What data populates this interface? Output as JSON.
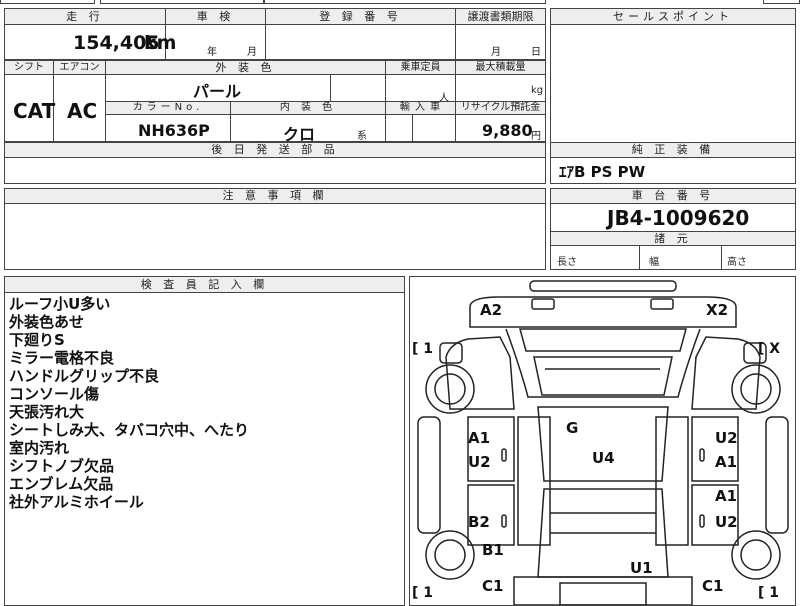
{
  "top": {
    "mileage_label": "走 行",
    "mileage_value": "154,405",
    "mileage_unit": "km",
    "inspection_label": "車 検",
    "inspection_year": "年",
    "inspection_month": "月",
    "registration_label": "登 録 番 号",
    "transfer_label": "譲渡書類期限",
    "transfer_month": "月",
    "transfer_day": "日",
    "sales_point_label": "セールスポイント"
  },
  "specs": {
    "shift_label": "シフト",
    "shift_value": "CAT",
    "aircon_label": "エアコン",
    "aircon_value": "AC",
    "exterior_color_label": "外 装 色",
    "exterior_color_value": "パール",
    "capacity_label": "乗車定員",
    "capacity_unit": "人",
    "max_load_label": "最大積載量",
    "max_load_unit": "kg",
    "color_no_label": "カラーNo.",
    "color_no_value": "NH636P",
    "interior_color_label": "内 装 色",
    "interior_color_value": "クロ",
    "interior_suffix": "系",
    "import_label": "輸 入 車",
    "recycle_label": "リサイクル預託金",
    "recycle_value": "9,880",
    "recycle_unit": "円"
  },
  "shipping_label": "後 日 発 送 部 品",
  "equipment_label": "純 正 装 備",
  "equipment_value": "ｴｱB PS PW",
  "notes_label": "注 意 事 項 欄",
  "chassis_label": "車 台 番 号",
  "chassis_value": "JB4-1009620",
  "dimensions_label": "諸 元",
  "dim_length": "長さ",
  "dim_width": "幅",
  "dim_height": "高さ",
  "inspector_label": "検 査 員 記 入 欄",
  "remarks": [
    "ルーフ小U多い",
    "外装色あせ",
    "下廻りS",
    "ミラー電格不良",
    "ハンドルグリップ不良",
    "コンソール傷",
    "天張汚れ大",
    "シートしみ大、タバコ穴中、へたり",
    "室内汚れ",
    "シフトノブ欠品",
    "エンブレム欠品",
    "社外アルミホイール"
  ],
  "diagram": {
    "top_left": "A2",
    "top_right": "X2",
    "bracket_left": "[ 1",
    "bracket_right": "[ X",
    "bracket_bottom_left": "[ 1",
    "bracket_bottom_right": "[ 1",
    "g": "G",
    "u4": "U4",
    "left_a1": "A1",
    "left_u2": "U2",
    "right_u2": "U2",
    "right_a1": "A1",
    "right_a1b": "A1",
    "right_u2b": "U2",
    "left_b2": "B2",
    "left_b1": "B1",
    "u1": "U1",
    "c1_left": "C1",
    "c1_right": "C1"
  }
}
